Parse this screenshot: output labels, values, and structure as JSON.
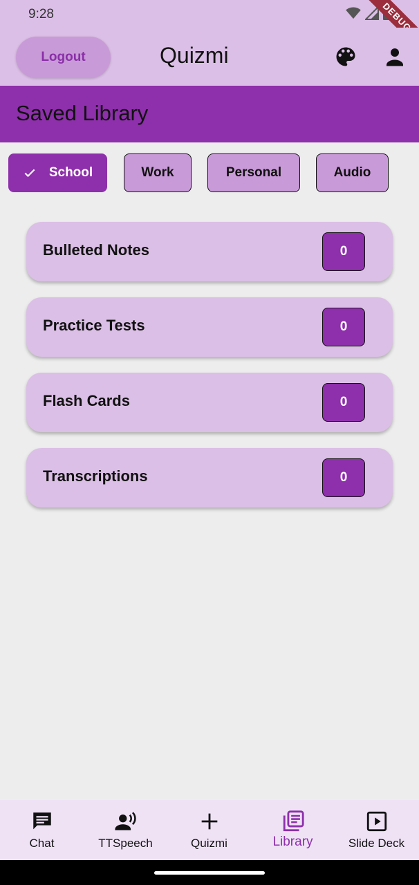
{
  "status_bar": {
    "time": "9:28",
    "debug_label": "DEBUG"
  },
  "app_bar": {
    "logout_label": "Logout",
    "title": "Quizmi"
  },
  "section": {
    "title": "Saved Library"
  },
  "chips": [
    {
      "label": "School",
      "selected": true
    },
    {
      "label": "Work",
      "selected": false
    },
    {
      "label": "Personal",
      "selected": false
    },
    {
      "label": "Audio",
      "selected": false
    }
  ],
  "cards": [
    {
      "label": "Bulleted Notes",
      "count": "0"
    },
    {
      "label": "Practice Tests",
      "count": "0"
    },
    {
      "label": "Flash Cards",
      "count": "0"
    },
    {
      "label": "Transcriptions",
      "count": "0"
    }
  ],
  "nav": [
    {
      "label": "Chat",
      "icon": "chat-icon",
      "active": false
    },
    {
      "label": "TTSpeech",
      "icon": "record-voice-icon",
      "active": false
    },
    {
      "label": "Quizmi",
      "icon": "plus-icon",
      "active": false
    },
    {
      "label": "Library",
      "icon": "library-books-icon",
      "active": true
    },
    {
      "label": "Slide Deck",
      "icon": "slideshow-icon",
      "active": false
    }
  ],
  "colors": {
    "primary": "#8e2fab",
    "app_bar": "#dbbfe6",
    "chip": "#c99ad8",
    "background": "#ededed",
    "nav_background": "#efe2f5"
  }
}
